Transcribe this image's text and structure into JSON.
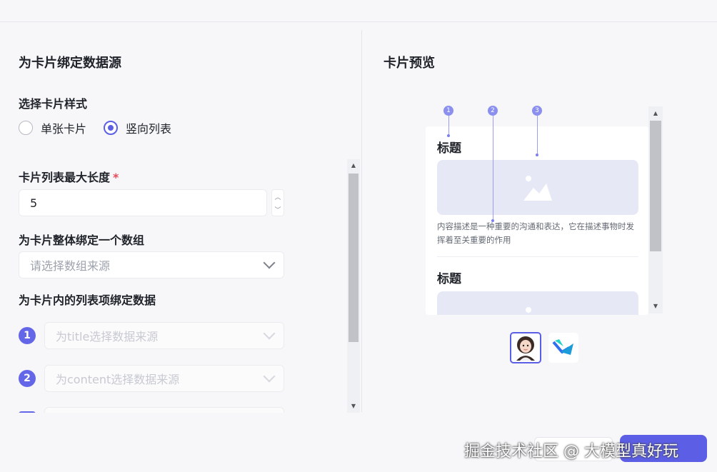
{
  "left_panel": {
    "title": "为卡片绑定数据源",
    "style_label": "选择卡片样式",
    "style_options": [
      {
        "label": "单张卡片",
        "selected": false
      },
      {
        "label": "竖向列表",
        "selected": true
      }
    ],
    "max_length_label": "卡片列表最大长度",
    "required_mark": "*",
    "max_length_value": "5",
    "array_label": "为卡片整体绑定一个数组",
    "array_placeholder": "请选择数组来源",
    "list_item_label": "为卡片内的列表项绑定数据",
    "list_items": [
      {
        "num": "1",
        "placeholder": "为title选择数据来源"
      },
      {
        "num": "2",
        "placeholder": "为content选择数据来源"
      }
    ]
  },
  "right_panel": {
    "title": "卡片预览",
    "annotations": [
      "1",
      "2",
      "3"
    ],
    "card_title": "标题",
    "card_desc": "内容描述是一种重要的沟通和表达，它在描述事物时发挥着至关重要的作用",
    "card_title_2": "标题"
  },
  "footer": {
    "watermark": "掘金技术社区 @ 大模型真好玩"
  },
  "colors": {
    "accent": "#5c5fe6",
    "badge": "#6466e8",
    "placeholder_bg": "#e7e8f6"
  }
}
